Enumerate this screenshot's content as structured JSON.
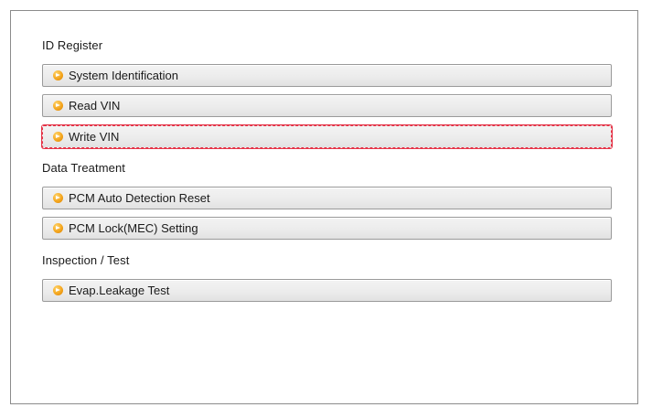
{
  "sections": [
    {
      "title": "ID Register",
      "items": [
        {
          "label": "System Identification",
          "icon": "orange-arrow-bullet-icon"
        },
        {
          "label": "Read VIN",
          "icon": "orange-arrow-bullet-icon"
        },
        {
          "label": "Write VIN",
          "icon": "orange-arrow-bullet-icon",
          "highlighted": true
        }
      ]
    },
    {
      "title": "Data Treatment",
      "items": [
        {
          "label": "PCM Auto Detection Reset",
          "icon": "orange-arrow-bullet-icon"
        },
        {
          "label": "PCM Lock(MEC) Setting",
          "icon": "orange-arrow-bullet-icon"
        }
      ]
    },
    {
      "title": "Inspection / Test",
      "items": [
        {
          "label": "Evap.Leakage Test",
          "icon": "orange-arrow-bullet-icon"
        }
      ]
    }
  ],
  "colors": {
    "highlight": "#e53347",
    "bullet": "#f4a61e",
    "border": "#9a9a9a"
  }
}
